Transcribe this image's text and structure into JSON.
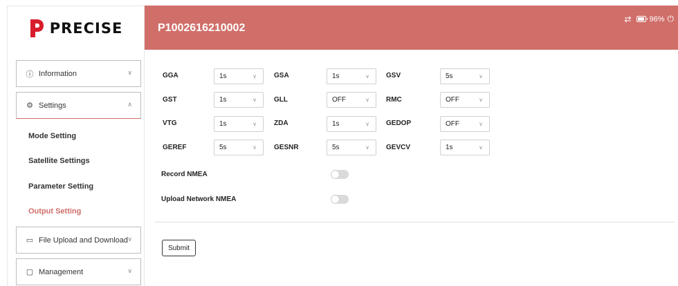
{
  "brand": {
    "logo_text": "PRECISE",
    "accent": "#d06f6a"
  },
  "header": {
    "device_id": "P1002616210002",
    "battery_label": "96%",
    "battery_level_percent": 96,
    "translate_icon": "translate-icon",
    "power_icon": "power-icon"
  },
  "sidebar": {
    "information": {
      "label": "Information",
      "icon": "info-icon"
    },
    "settings": {
      "label": "Settings",
      "icon": "gear-icon"
    },
    "sub_items": [
      "Mode Setting",
      "Satellite Settings",
      "Parameter Setting",
      "Output Setting"
    ],
    "active_sub_item": "Output Setting",
    "file_transfer": {
      "label": "File Upload and Download",
      "icon": "folder-icon"
    },
    "management": {
      "label": "Management",
      "icon": "monitor-icon"
    }
  },
  "output": {
    "rows": [
      [
        {
          "label": "GGA",
          "value": "1s"
        },
        {
          "label": "GSA",
          "value": "1s"
        },
        {
          "label": "GSV",
          "value": "5s"
        }
      ],
      [
        {
          "label": "GST",
          "value": "1s"
        },
        {
          "label": "GLL",
          "value": "OFF"
        },
        {
          "label": "RMC",
          "value": "OFF"
        }
      ],
      [
        {
          "label": "VTG",
          "value": "1s"
        },
        {
          "label": "ZDA",
          "value": "1s"
        },
        {
          "label": "GEDOP",
          "value": "OFF"
        }
      ],
      [
        {
          "label": "GEREF",
          "value": "5s"
        },
        {
          "label": "GESNR",
          "value": "5s"
        },
        {
          "label": "GEVCV",
          "value": "1s"
        }
      ]
    ],
    "record_nmea": {
      "label": "Record NMEA",
      "enabled": false
    },
    "upload_network_nmea": {
      "label": "Upload Network NMEA",
      "enabled": false
    },
    "submit_label": "Submit"
  }
}
